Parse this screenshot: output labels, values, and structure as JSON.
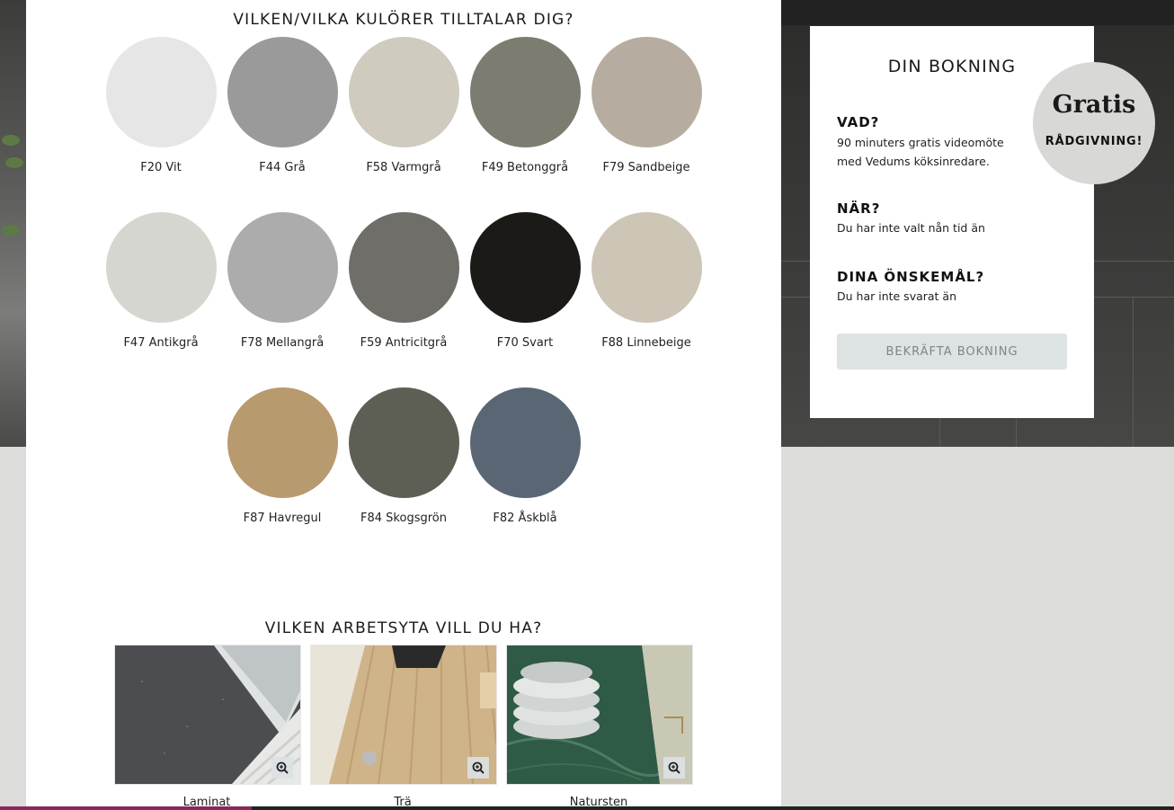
{
  "colors_section": {
    "title": "VILKEN/VILKA KULÖRER TILLTALAR DIG?",
    "swatches": [
      {
        "label": "F20 Vit",
        "color": "#e6e6e6"
      },
      {
        "label": "F44 Grå",
        "color": "#9a9a9a"
      },
      {
        "label": "F58 Varmgrå",
        "color": "#cfcbbf"
      },
      {
        "label": "F49 Betonggrå",
        "color": "#7d7c70"
      },
      {
        "label": "F79 Sandbeige",
        "color": "#b6ada0"
      },
      {
        "label": "F47 Antikgrå",
        "color": "#d6d6d0"
      },
      {
        "label": "F78 Mellangrå",
        "color": "#acacac"
      },
      {
        "label": "F59 Antricitgrå",
        "color": "#6f6e69"
      },
      {
        "label": "F70 Svart",
        "color": "#1b1a17"
      },
      {
        "label": "F88 Linnebeige",
        "color": "#cdc5b6"
      },
      {
        "label": "F87 Havregul",
        "color": "#b89a6f"
      },
      {
        "label": "F84 Skogsgrön",
        "color": "#5d5f55"
      },
      {
        "label": "F82 Åskblå",
        "color": "#5a6673"
      }
    ]
  },
  "surface_section": {
    "title": "VILKEN ARBETSYTA VILL DU HA?",
    "options": [
      {
        "label": "Laminat",
        "image": "dark-laminate-countertop",
        "zoom_icon": "zoom-in-icon"
      },
      {
        "label": "Trä",
        "image": "wood-countertop",
        "zoom_icon": "zoom-in-icon"
      },
      {
        "label": "Natursten",
        "image": "green-marble-countertop",
        "zoom_icon": "zoom-in-icon"
      }
    ]
  },
  "booking": {
    "title": "DIN BOKNING",
    "what_label": "VAD?",
    "what_value": "90 minuters gratis videomöte med Vedums köksinredare.",
    "when_label": "NÄR?",
    "when_value": "Du har inte valt nån tid än",
    "wishes_label": "DINA ÖNSKEMÅL?",
    "wishes_value": "Du har inte svarat än",
    "confirm_label": "BEKRÄFTA BOKNING"
  },
  "badge": {
    "big": "Gratis",
    "small": "RÅDGIVNING!"
  }
}
